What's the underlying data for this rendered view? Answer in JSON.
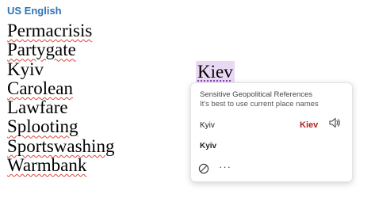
{
  "document": {
    "language_label": "US English",
    "words": [
      "Permacrisis",
      "Partygate",
      "Kyiv",
      "Carolean",
      "Lawfare",
      "Splooting",
      "Sportswashing",
      "Warmbank"
    ],
    "flagged_word": "Kiev"
  },
  "card": {
    "title": "Sensitive Geopolitical References",
    "subtitle": "It's best to use current place names",
    "original_text": "Kyiv",
    "flagged_text": "Kiev",
    "replacement": "Kyiv",
    "icons": {
      "read_aloud": "speaker-icon",
      "ignore": "block-icon",
      "more": "ellipsis-icon"
    },
    "more_label": "···"
  },
  "colors": {
    "language_label": "#2e74b5",
    "flag_text": "#b4211e",
    "flag_highlight": "#ead9f5",
    "spelling_squiggle": "#e0453c"
  }
}
